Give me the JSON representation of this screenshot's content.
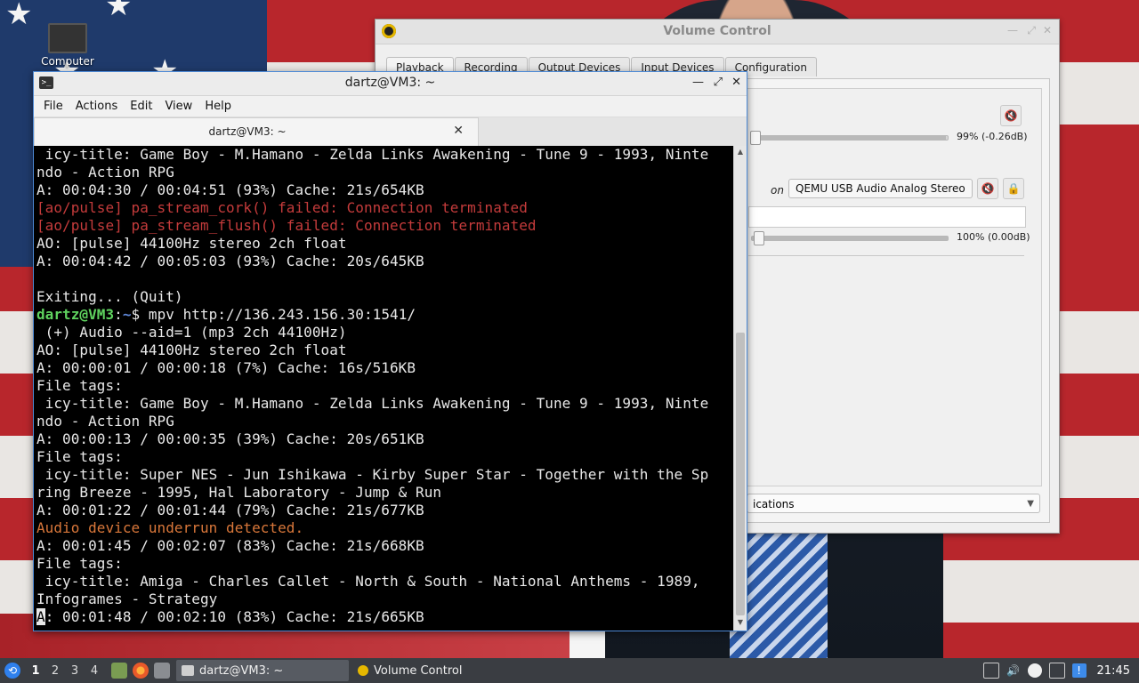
{
  "desktop": {
    "icon_label": "Computer"
  },
  "volume_control": {
    "title": "Volume Control",
    "tabs": [
      "Playback",
      "Recording",
      "Output Devices",
      "Input Devices",
      "Configuration"
    ],
    "active_tab": "Playback",
    "stream1_volume_label": "99% (-0.26dB)",
    "stream1_volume_level": 0.99,
    "on_label": "on",
    "device_button": "QEMU USB Audio Analog Stereo",
    "stream2_volume_label": "100% (0.00dB)",
    "stream2_volume_level": 1.0,
    "show_select_value": "ications"
  },
  "terminal": {
    "title": "dartz@VM3: ~",
    "menu": [
      "File",
      "Actions",
      "Edit",
      "View",
      "Help"
    ],
    "tab_label": "dartz@VM3: ~",
    "lines": [
      {
        "type": "normal",
        "text": " icy-title: Game Boy - M.Hamano - Zelda Links Awakening - Tune 9 - 1993, Ninte"
      },
      {
        "type": "normal",
        "text": "ndo - Action RPG"
      },
      {
        "type": "normal",
        "text": "A: 00:04:30 / 00:04:51 (93%) Cache: 21s/654KB"
      },
      {
        "type": "err",
        "text": "[ao/pulse] pa_stream_cork() failed: Connection terminated"
      },
      {
        "type": "err",
        "text": "[ao/pulse] pa_stream_flush() failed: Connection terminated"
      },
      {
        "type": "normal",
        "text": "AO: [pulse] 44100Hz stereo 2ch float"
      },
      {
        "type": "normal",
        "text": "A: 00:04:42 / 00:05:03 (93%) Cache: 20s/645KB"
      },
      {
        "type": "normal",
        "text": ""
      },
      {
        "type": "normal",
        "text": "Exiting... (Quit)"
      },
      {
        "type": "prompt",
        "user": "dartz@VM3",
        "sep": ":",
        "path": "~",
        "cmd": "$ mpv http://136.243.156.30:1541/"
      },
      {
        "type": "normal",
        "text": " (+) Audio --aid=1 (mp3 2ch 44100Hz)"
      },
      {
        "type": "normal",
        "text": "AO: [pulse] 44100Hz stereo 2ch float"
      },
      {
        "type": "normal",
        "text": "A: 00:00:01 / 00:00:18 (7%) Cache: 16s/516KB"
      },
      {
        "type": "normal",
        "text": "File tags:"
      },
      {
        "type": "normal",
        "text": " icy-title: Game Boy - M.Hamano - Zelda Links Awakening - Tune 9 - 1993, Ninte"
      },
      {
        "type": "normal",
        "text": "ndo - Action RPG"
      },
      {
        "type": "normal",
        "text": "A: 00:00:13 / 00:00:35 (39%) Cache: 20s/651KB"
      },
      {
        "type": "normal",
        "text": "File tags:"
      },
      {
        "type": "normal",
        "text": " icy-title: Super NES - Jun Ishikawa - Kirby Super Star - Together with the Sp"
      },
      {
        "type": "normal",
        "text": "ring Breeze - 1995, Hal Laboratory - Jump & Run"
      },
      {
        "type": "normal",
        "text": "A: 00:01:22 / 00:01:44 (79%) Cache: 21s/677KB"
      },
      {
        "type": "warn",
        "text": "Audio device underrun detected."
      },
      {
        "type": "normal",
        "text": "A: 00:01:45 / 00:02:07 (83%) Cache: 21s/668KB"
      },
      {
        "type": "normal",
        "text": "File tags:"
      },
      {
        "type": "normal",
        "text": " icy-title: Amiga - Charles Callet - North & South - National Anthems - 1989,"
      },
      {
        "type": "normal",
        "text": "Infogrames - Strategy"
      },
      {
        "type": "cursor",
        "cursor_char": "A",
        "text": ": 00:01:48 / 00:02:10 (83%) Cache: 21s/665KB"
      }
    ]
  },
  "taskbar": {
    "workspaces": [
      "1",
      "2",
      "3",
      "4"
    ],
    "active_workspace": "1",
    "tasks": [
      {
        "label": "dartz@VM3: ~",
        "active": true
      },
      {
        "label": "Volume Control",
        "active": false
      }
    ],
    "clock": "21:45"
  },
  "colors": {
    "terminal_bg": "#000000",
    "prompt_user": "#5fd35f",
    "prompt_path": "#5f87d7",
    "error_text": "#c43b3b",
    "warning_text": "#d9773a",
    "taskbar_bg": "#3a3d42",
    "window_focus_border": "#4d8ad6"
  }
}
